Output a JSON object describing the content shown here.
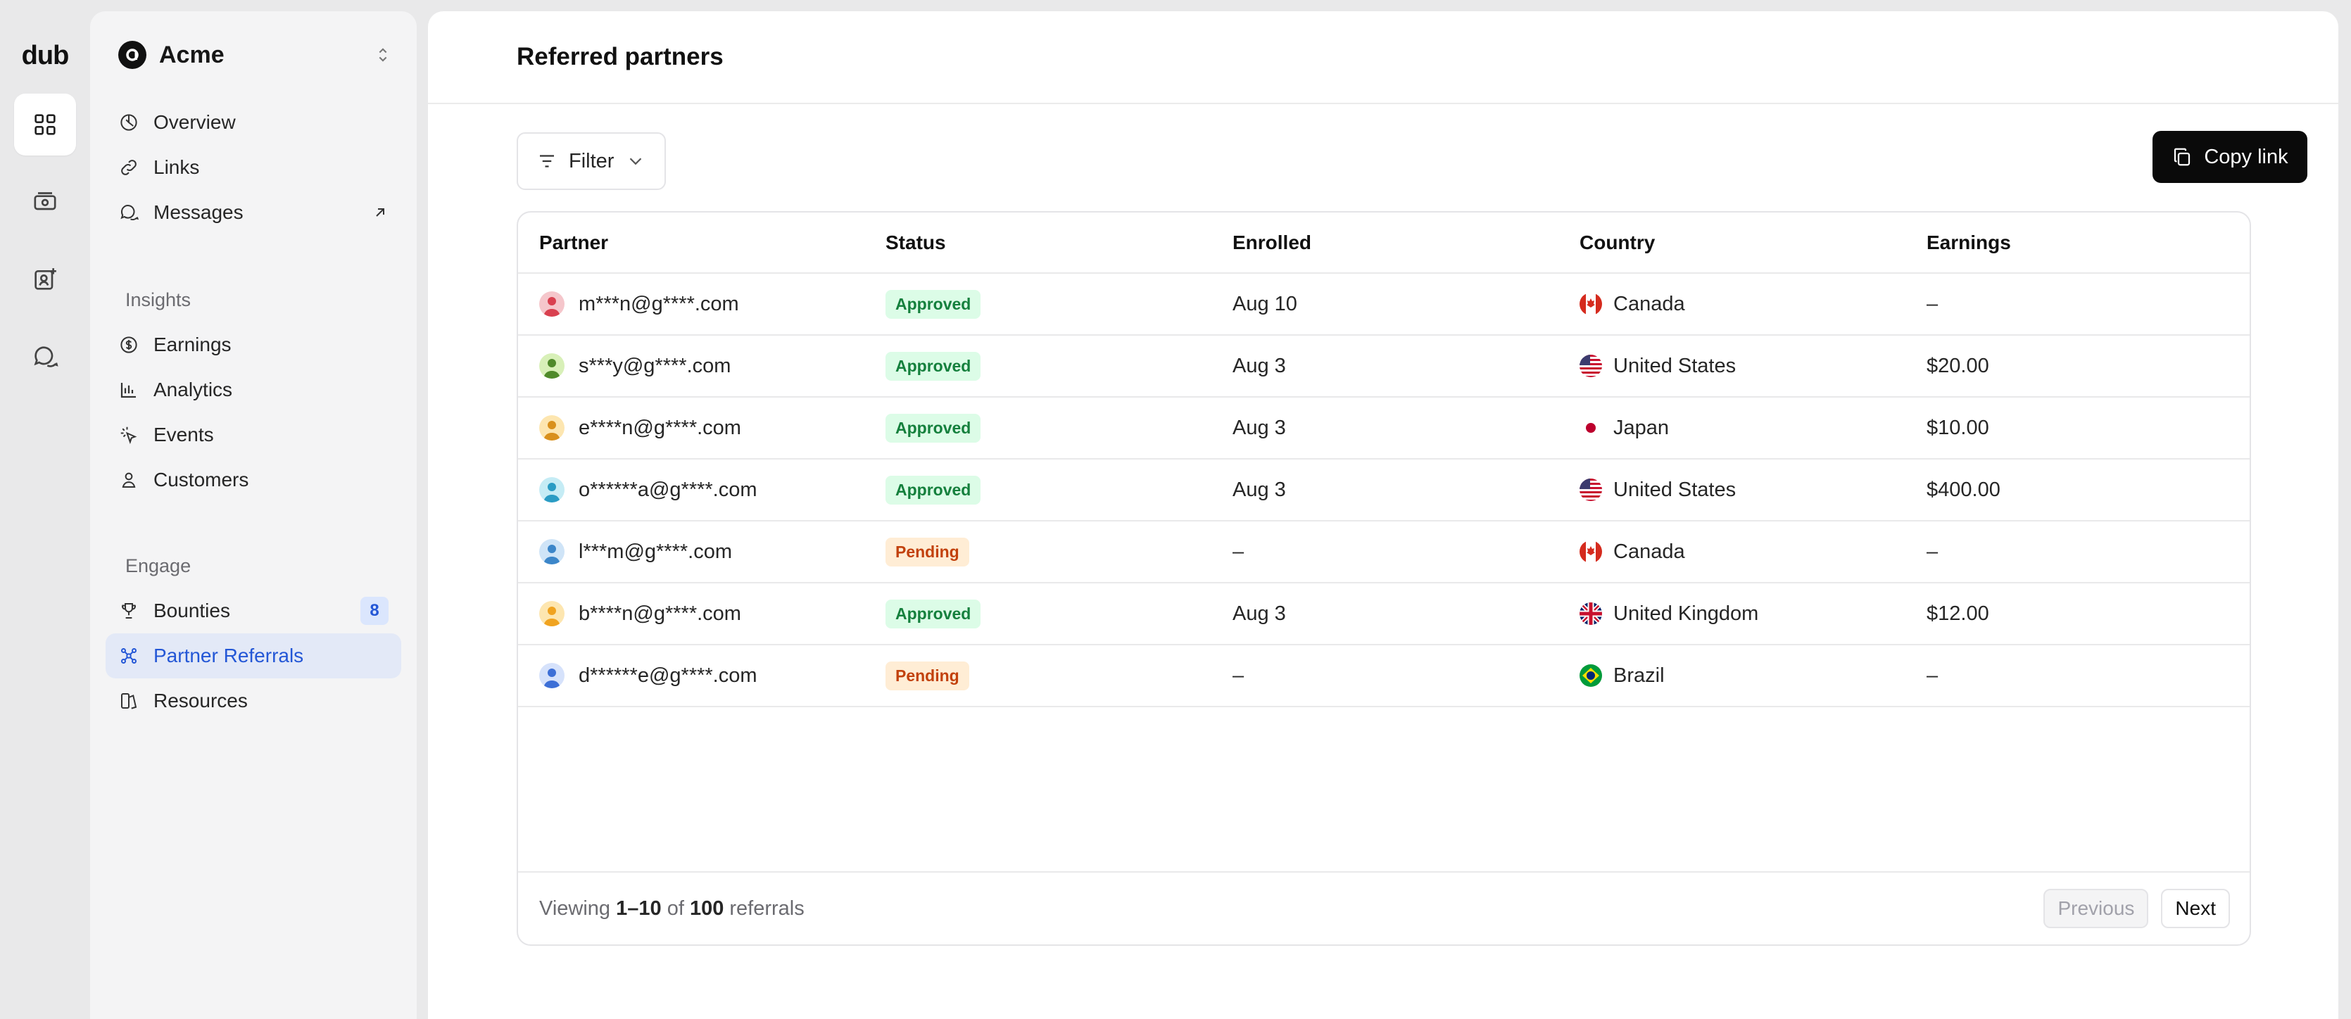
{
  "rail": {
    "logo": "dub",
    "items": [
      {
        "icon": "grid-icon",
        "active": true
      },
      {
        "icon": "money-icon",
        "active": false
      },
      {
        "icon": "user-plus-icon",
        "active": false
      },
      {
        "icon": "chat-icon",
        "active": false
      }
    ]
  },
  "sidebar": {
    "workspace": "Acme",
    "top_items": [
      {
        "label": "Overview",
        "icon": "overview-icon"
      },
      {
        "label": "Links",
        "icon": "link-icon"
      },
      {
        "label": "Messages",
        "icon": "messages-icon",
        "trailing": "external-arrow-icon"
      }
    ],
    "sections": [
      {
        "label": "Insights",
        "items": [
          {
            "label": "Earnings",
            "icon": "dollar-icon"
          },
          {
            "label": "Analytics",
            "icon": "bar-chart-icon"
          },
          {
            "label": "Events",
            "icon": "cursor-click-icon"
          },
          {
            "label": "Customers",
            "icon": "user-icon"
          }
        ]
      },
      {
        "label": "Engage",
        "items": [
          {
            "label": "Bounties",
            "icon": "trophy-icon",
            "badge": "8"
          },
          {
            "label": "Partner Referrals",
            "icon": "network-icon",
            "active": true
          },
          {
            "label": "Resources",
            "icon": "resources-icon"
          }
        ]
      }
    ]
  },
  "header": {
    "title": "Referred partners"
  },
  "toolbar": {
    "filter_label": "Filter",
    "copy_label": "Copy link"
  },
  "table": {
    "columns": [
      "Partner",
      "Status",
      "Enrolled",
      "Country",
      "Earnings"
    ],
    "rows": [
      {
        "partner": "m***n@g****.com",
        "avatar_color": "#f5c6cb",
        "avatar_fg": "#d9404f",
        "status": "Approved",
        "enrolled": "Aug 10",
        "country": "Canada",
        "flag": "ca",
        "earnings": "–"
      },
      {
        "partner": "s***y@g****.com",
        "avatar_color": "#d8f0b8",
        "avatar_fg": "#4f8a2a",
        "status": "Approved",
        "enrolled": "Aug 3",
        "country": "United States",
        "flag": "us",
        "earnings": "$20.00"
      },
      {
        "partner": "e****n@g****.com",
        "avatar_color": "#fde6b0",
        "avatar_fg": "#d9901c",
        "status": "Approved",
        "enrolled": "Aug 3",
        "country": "Japan",
        "flag": "jp",
        "earnings": "$10.00"
      },
      {
        "partner": "o******a@g****.com",
        "avatar_color": "#c5ecf5",
        "avatar_fg": "#2a9cc4",
        "status": "Approved",
        "enrolled": "Aug 3",
        "country": "United States",
        "flag": "us",
        "earnings": "$400.00"
      },
      {
        "partner": "l***m@g****.com",
        "avatar_color": "#cfe4f7",
        "avatar_fg": "#3c86c9",
        "status": "Pending",
        "enrolled": "–",
        "country": "Canada",
        "flag": "ca",
        "earnings": "–"
      },
      {
        "partner": "b****n@g****.com",
        "avatar_color": "#fde6b0",
        "avatar_fg": "#f0a320",
        "status": "Approved",
        "enrolled": "Aug 3",
        "country": "United Kingdom",
        "flag": "gb",
        "earnings": "$12.00"
      },
      {
        "partner": "d******e@g****.com",
        "avatar_color": "#d6e2fb",
        "avatar_fg": "#3d6fd6",
        "status": "Pending",
        "enrolled": "–",
        "country": "Brazil",
        "flag": "br",
        "earnings": "–"
      }
    ],
    "status_colors": {
      "Approved": {
        "bg": "#dcfce7",
        "fg": "#15803d"
      },
      "Pending": {
        "bg": "#ffedd5",
        "fg": "#c2410c"
      }
    }
  },
  "footer": {
    "viewing_prefix": "Viewing",
    "range": "1–10",
    "of_word": "of",
    "total": "100",
    "suffix": "referrals",
    "previous_label": "Previous",
    "next_label": "Next"
  },
  "colors": {
    "accent": "#2457d6",
    "active_bg": "#e3e9f7"
  }
}
